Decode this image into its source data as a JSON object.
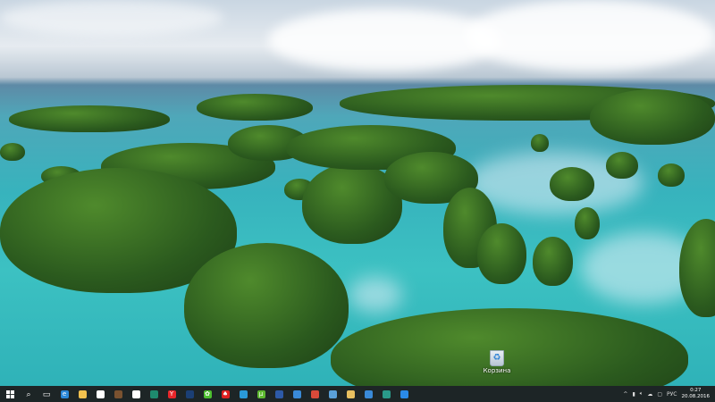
{
  "desktop": {
    "icons": [
      {
        "name": "recycle-bin",
        "label": "Корзина"
      }
    ]
  },
  "taskbar": {
    "start_label": "Start",
    "apps": [
      {
        "name": "search",
        "glyph": "⌕",
        "color": "#ffffff"
      },
      {
        "name": "task-view",
        "glyph": "▭",
        "color": "#ffffff"
      },
      {
        "name": "edge",
        "glyph": "e",
        "color": "#2b88d8"
      },
      {
        "name": "file-explorer",
        "glyph": "",
        "color": "#f2c14e"
      },
      {
        "name": "store",
        "glyph": "",
        "color": "#ffffff"
      },
      {
        "name": "minecraft",
        "glyph": "",
        "color": "#7a5230"
      },
      {
        "name": "solitaire",
        "glyph": "♣",
        "color": "#ffffff"
      },
      {
        "name": "app-green",
        "glyph": "",
        "color": "#1e8a6e"
      },
      {
        "name": "yandex-browser",
        "glyph": "Y",
        "color": "#e8262a"
      },
      {
        "name": "steam",
        "glyph": "",
        "color": "#1b3f75"
      },
      {
        "name": "icq",
        "glyph": "✿",
        "color": "#4cbf2f"
      },
      {
        "name": "card-game",
        "glyph": "♠",
        "color": "#e02020"
      },
      {
        "name": "app-blue",
        "glyph": "",
        "color": "#2a9ad8"
      },
      {
        "name": "utorrent",
        "glyph": "µ",
        "color": "#5db830"
      },
      {
        "name": "app-window",
        "glyph": "",
        "color": "#2d5aa8"
      },
      {
        "name": "app-settings",
        "glyph": "",
        "color": "#3a8ad8"
      },
      {
        "name": "chrome",
        "glyph": "",
        "color": "#d84a3a"
      },
      {
        "name": "app-installer",
        "glyph": "",
        "color": "#5aa0d8"
      },
      {
        "name": "folder-app",
        "glyph": "",
        "color": "#e8c060"
      },
      {
        "name": "remote-desktop",
        "glyph": "",
        "color": "#3a8ad8"
      },
      {
        "name": "app-photo",
        "glyph": "",
        "color": "#2a9a8a"
      },
      {
        "name": "app-circle",
        "glyph": "",
        "color": "#2a8ae8"
      }
    ],
    "tray": {
      "chevron": "^",
      "language": "РУС",
      "time": "0:27",
      "date": "20.08.2016"
    }
  }
}
